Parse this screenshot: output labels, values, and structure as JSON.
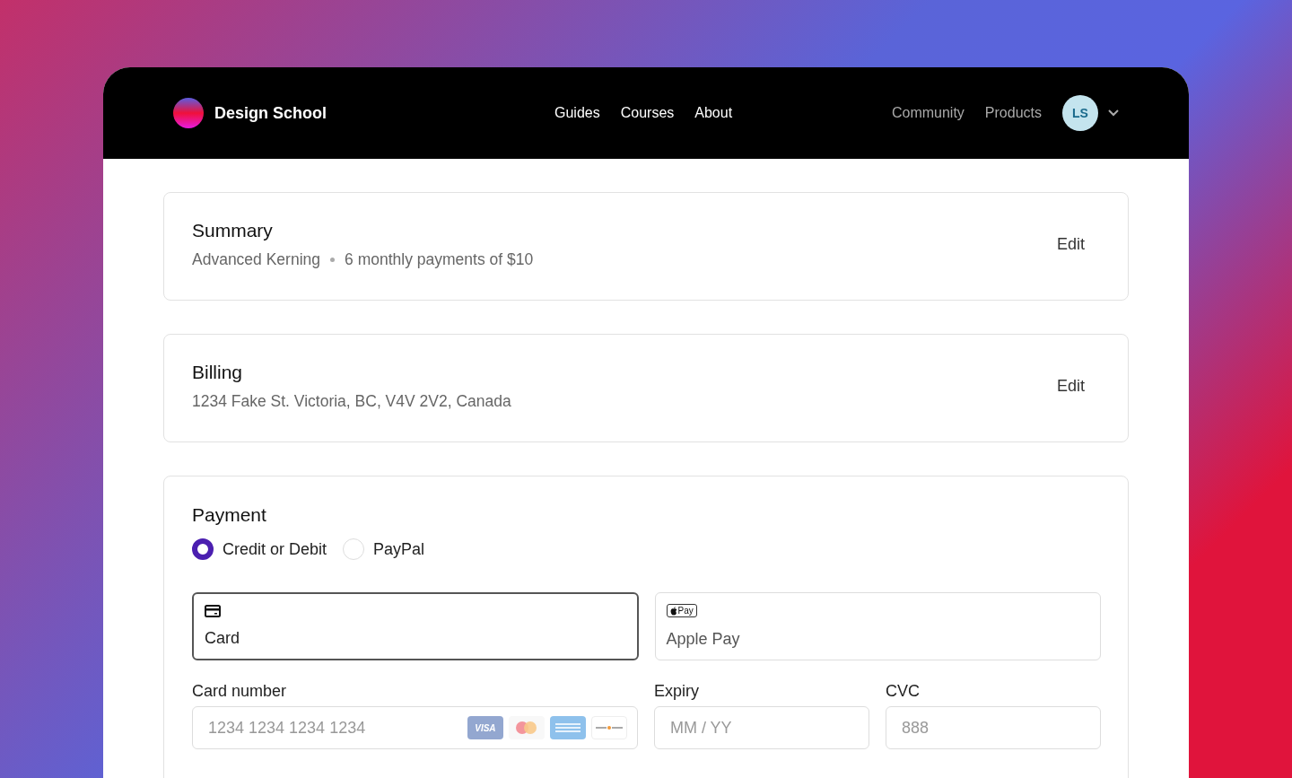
{
  "brand": {
    "name": "Design School"
  },
  "nav": {
    "center": [
      {
        "label": "Guides"
      },
      {
        "label": "Courses"
      },
      {
        "label": "About"
      }
    ],
    "right": [
      {
        "label": "Community"
      },
      {
        "label": "Products"
      }
    ],
    "avatar": {
      "initials": "LS"
    }
  },
  "summary": {
    "title": "Summary",
    "items": [
      "Advanced Kerning",
      "6 monthly payments of $10"
    ],
    "action": "Edit"
  },
  "billing": {
    "title": "Billing",
    "address": "1234 Fake St. Victoria, BC, V4V 2V2, Canada",
    "action": "Edit"
  },
  "payment": {
    "title": "Payment",
    "radios": [
      {
        "label": "Credit or Debit",
        "selected": true
      },
      {
        "label": "PayPal",
        "selected": false
      }
    ],
    "methods": [
      {
        "kind": "card",
        "label": "Card",
        "selected": true
      },
      {
        "kind": "applepay",
        "badge": "Pay",
        "label": "Apple Pay",
        "selected": false
      }
    ],
    "fields": [
      {
        "kind": "card_number",
        "label": "Card number",
        "placeholder": "1234 1234 1234 1234",
        "brands": [
          {
            "kind": "visa",
            "text": "VISA"
          },
          {
            "kind": "mastercard"
          },
          {
            "kind": "amex"
          },
          {
            "kind": "discover"
          }
        ]
      },
      {
        "kind": "text",
        "label": "Expiry",
        "placeholder": "MM / YY"
      },
      {
        "kind": "text",
        "label": "CVC",
        "placeholder": "888"
      }
    ]
  }
}
